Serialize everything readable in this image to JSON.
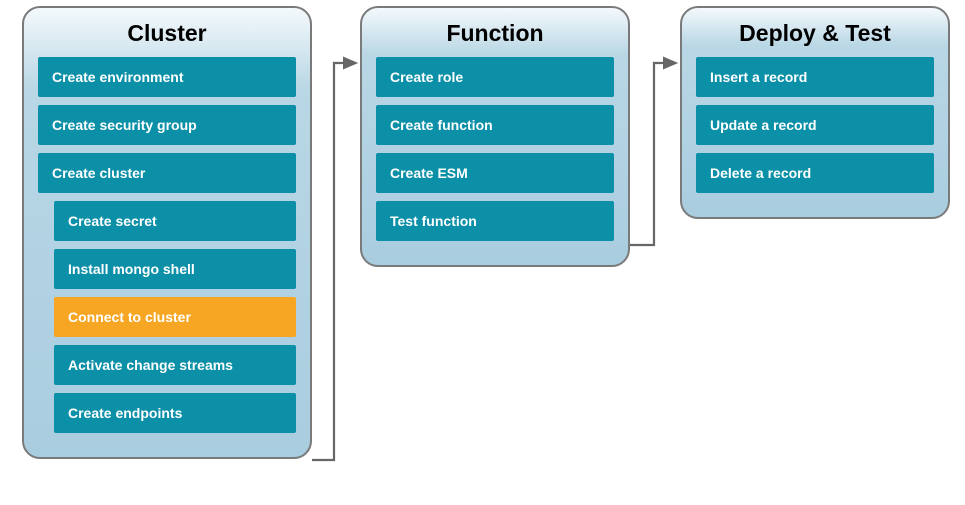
{
  "panels": {
    "cluster": {
      "title": "Cluster",
      "steps": [
        {
          "label": "Create environment",
          "indent": false,
          "highlight": false
        },
        {
          "label": "Create security group",
          "indent": false,
          "highlight": false
        },
        {
          "label": "Create cluster",
          "indent": false,
          "highlight": false
        },
        {
          "label": "Create secret",
          "indent": true,
          "highlight": false
        },
        {
          "label": "Install mongo shell",
          "indent": true,
          "highlight": false
        },
        {
          "label": "Connect to cluster",
          "indent": true,
          "highlight": true
        },
        {
          "label": "Activate change streams",
          "indent": true,
          "highlight": false
        },
        {
          "label": "Create endpoints",
          "indent": true,
          "highlight": false
        }
      ]
    },
    "function": {
      "title": "Function",
      "steps": [
        {
          "label": "Create role",
          "indent": false,
          "highlight": false
        },
        {
          "label": "Create function",
          "indent": false,
          "highlight": false
        },
        {
          "label": "Create ESM",
          "indent": false,
          "highlight": false
        },
        {
          "label": "Test function",
          "indent": false,
          "highlight": false
        }
      ]
    },
    "deploy": {
      "title": "Deploy & Test",
      "steps": [
        {
          "label": "Insert a record",
          "indent": false,
          "highlight": false
        },
        {
          "label": "Update a record",
          "indent": false,
          "highlight": false
        },
        {
          "label": "Delete a record",
          "indent": false,
          "highlight": false
        }
      ]
    }
  }
}
